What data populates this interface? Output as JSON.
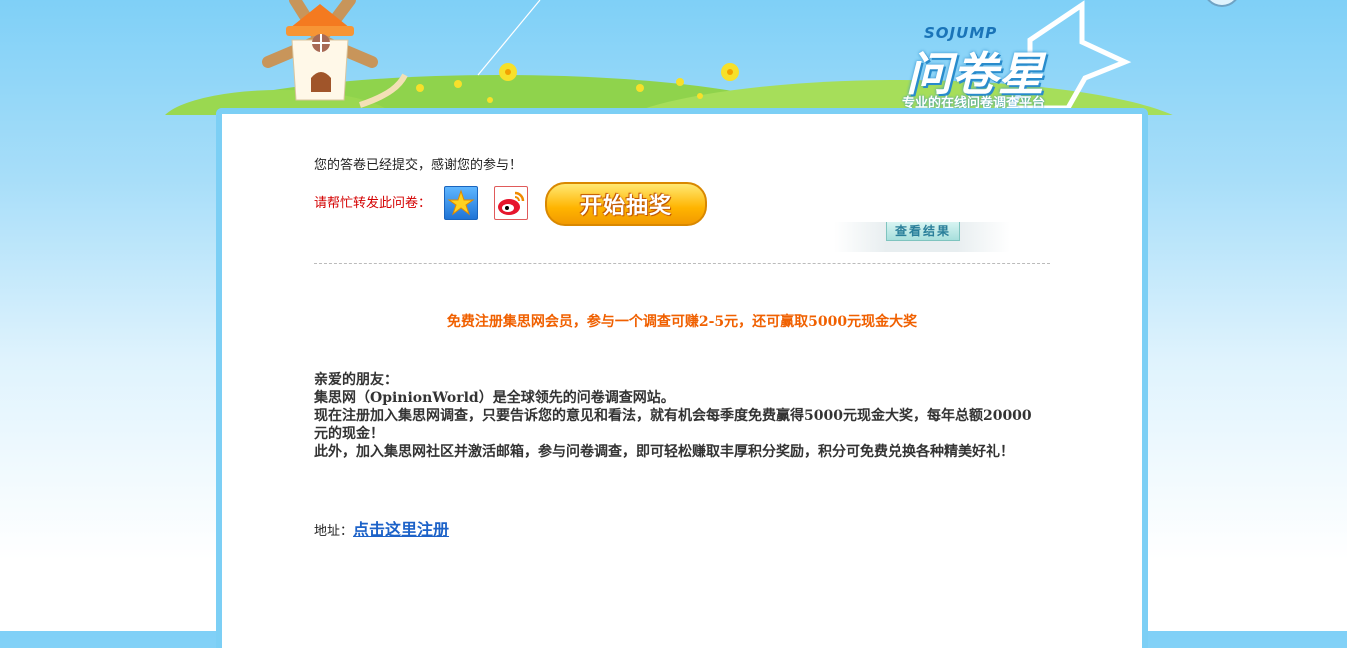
{
  "header": {
    "logo_brand": "SOJUMP",
    "logo_name": "问卷星",
    "logo_slogan": "专业的在线问卷调查平台"
  },
  "main": {
    "thanks_text": "您的答卷已经提交，感谢您的参与！",
    "share_label": "请帮忙转发此问卷：",
    "share_icons": [
      "qzone-icon",
      "weibo-icon"
    ],
    "lottery_button": "开始抽奖",
    "result_button": "查看结果",
    "promo_text": "免费注册集思网会员，参与一个调查可赚2-5元，还可赢取5000元现金大奖",
    "letter": [
      "亲爱的朋友：",
      "集思网（OpinionWorld）是全球领先的问卷调查网站。",
      "现在注册加入集思网调查，只要告诉您的意见和看法，就有机会每季度免费赢得5000元现金大奖，每年总额20000元的现金！",
      "此外，加入集思网社区并激活邮箱，参与问卷调查，即可轻松赚取丰厚积分奖励，积分可免费兑换各种精美好礼！"
    ],
    "address_label": "地址：",
    "register_link": "点击这里注册"
  },
  "colors": {
    "sky": "#7fd0f7",
    "card_border": "#7ccff5",
    "promo": "#f06000",
    "share_label": "#d40000",
    "link": "#1c62c8"
  }
}
